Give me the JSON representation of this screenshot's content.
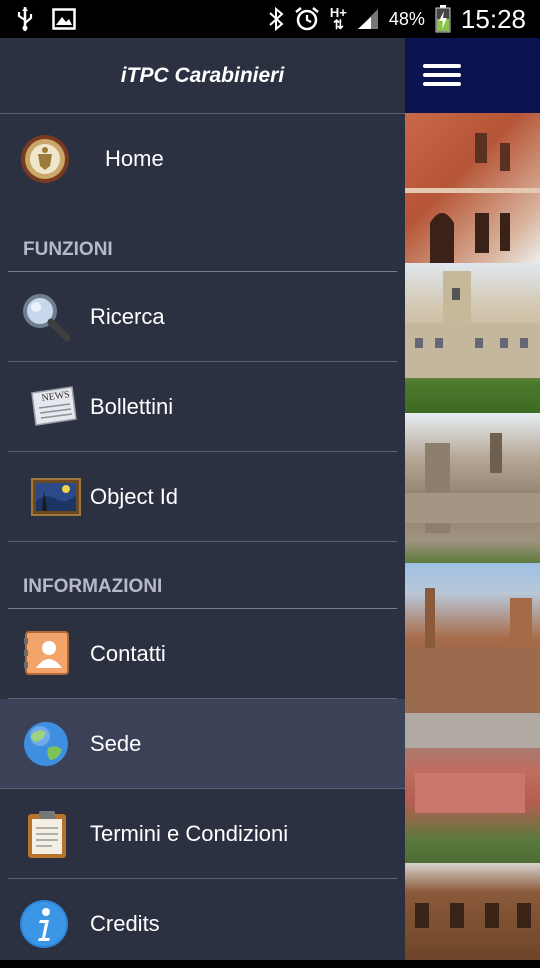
{
  "status_bar": {
    "network": "H+",
    "battery_percent": "48%",
    "time": "15:28"
  },
  "drawer": {
    "title": "iTPC Carabinieri",
    "home_label": "Home",
    "sections": {
      "funzioni": "FUNZIONI",
      "informazioni": "INFORMAZIONI"
    },
    "items": {
      "ricerca": "Ricerca",
      "bollettini": "Bollettini",
      "object_id": "Object Id",
      "contatti": "Contatti",
      "sede": "Sede",
      "termini": "Termini e Condizioni",
      "credits": "Credits"
    },
    "selected_item": "Sede"
  },
  "icons": {
    "home": "carabinieri-emblem-icon",
    "ricerca": "magnifier-icon",
    "bollettini": "newspaper-icon",
    "object_id": "painting-icon",
    "contatti": "contact-card-icon",
    "sede": "globe-icon",
    "termini": "clipboard-icon",
    "credits": "info-icon"
  },
  "colors": {
    "drawer_bg": "#2c3142",
    "selected_bg": "#3b4258",
    "header_right": "#0a1450"
  }
}
